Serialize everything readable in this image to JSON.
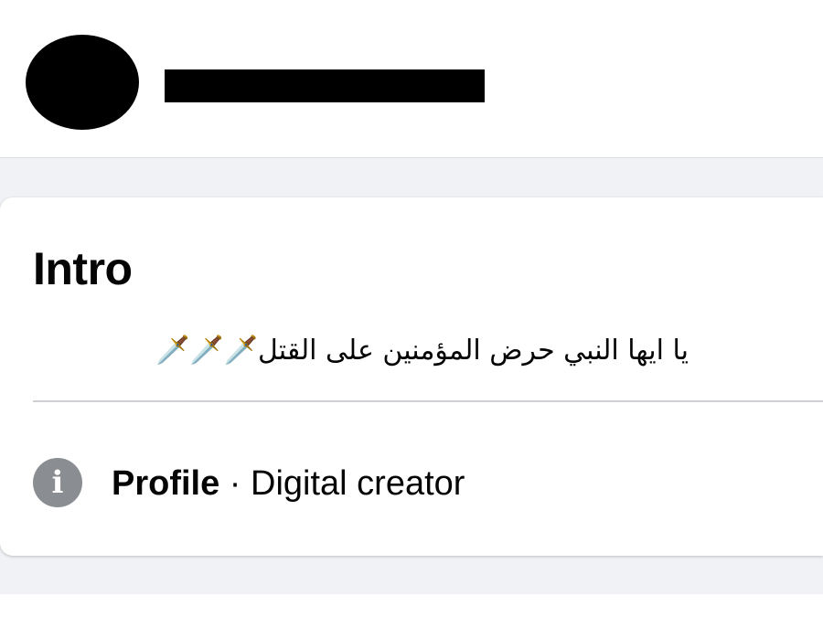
{
  "profile": {
    "avatar_icon": "redacted-avatar",
    "name_redacted": true
  },
  "intro": {
    "title": "Intro",
    "bio": "يا ايها النبي حرض المؤمنين على القتل🗡️🗡️🗡️",
    "info_icon": "info-icon",
    "profile_label": "Profile",
    "separator": " · ",
    "category": "Digital creator"
  },
  "colors": {
    "page_background": "#f0f2f5",
    "card_background": "#ffffff",
    "text": "#050505",
    "divider": "#ced0d4",
    "info_icon": "#8a8d91"
  }
}
